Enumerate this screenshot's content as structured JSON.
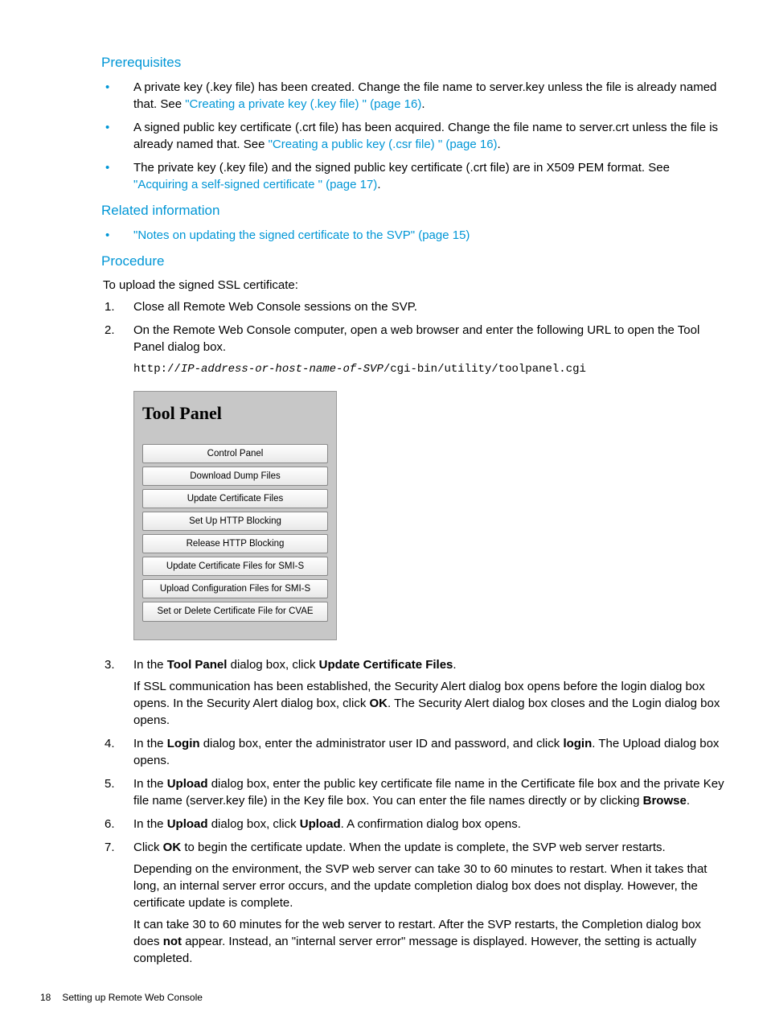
{
  "headings": {
    "prerequisites": "Prerequisites",
    "related": "Related information",
    "procedure": "Procedure"
  },
  "prereq": {
    "items": [
      {
        "text_a": "A private key (.key file) has been created. Change the file name to server.key unless the file is already named that. See ",
        "link": "\"Creating a private key (.key file) \" (page 16)",
        "text_b": "."
      },
      {
        "text_a": "A signed public key certificate (.crt file) has been acquired. Change the file name to server.crt unless the file is already named that. See ",
        "link": "\"Creating a public key (.csr file) \" (page 16)",
        "text_b": "."
      },
      {
        "text_a": "The private key (.key file) and the signed public key certificate (.crt file) are in X509 PEM format. See ",
        "link": "\"Acquiring a self-signed certificate \" (page 17)",
        "text_b": "."
      }
    ]
  },
  "related_link": "\"Notes on updating the signed certificate to the SVP\" (page 15)",
  "procedure": {
    "intro": "To upload the signed SSL certificate:",
    "step1": "Close all Remote Web Console sessions on the SVP.",
    "step2": "On the Remote Web Console computer, open a web browser and enter the following URL to open the Tool Panel dialog box.",
    "url_prefix": "http://",
    "url_host": "IP-address-or-host-name-of-SVP",
    "url_path": "/cgi-bin/utility/toolpanel.cgi",
    "step3": {
      "a": "In the ",
      "b1": "Tool Panel",
      "c": " dialog box, click ",
      "b2": "Update Certificate Files",
      "d": ".",
      "p1a": "If SSL communication has been established, the Security Alert dialog box opens before the login dialog box opens. In the Security Alert dialog box, click ",
      "p1b": "OK",
      "p1c": ". The Security Alert dialog box closes and the Login dialog box opens."
    },
    "step4": {
      "a": "In the ",
      "b1": "Login",
      "c": " dialog box, enter the administrator user ID and password, and click ",
      "b2": "login",
      "d": ". The Upload dialog box opens."
    },
    "step5": {
      "a": "In the ",
      "b1": "Upload",
      "c": " dialog box, enter the public key certificate file name in the Certificate file box and the private Key file name (server.key file) in the Key file box. You can enter the file names directly or by clicking ",
      "b2": "Browse",
      "d": "."
    },
    "step6": {
      "a": "In the ",
      "b1": "Upload",
      "c": " dialog box, click ",
      "b2": "Upload",
      "d": ". A confirmation dialog box opens."
    },
    "step7": {
      "a": "Click ",
      "b1": "OK",
      "c": " to begin the certificate update. When the update is complete, the SVP web server restarts.",
      "p1": "Depending on the environment, the SVP web server can take 30 to 60 minutes to restart. When it takes that long, an internal server error occurs, and the update completion dialog box does not display. However, the certificate update is complete.",
      "p2a": "It can take 30 to 60 minutes for the web server to restart. After the SVP restarts, the Completion dialog box does ",
      "p2b": "not",
      "p2c": " appear. Instead, an \"internal server error\" message is displayed. However, the setting is actually completed."
    }
  },
  "tool_panel": {
    "title": "Tool Panel",
    "buttons": [
      "Control Panel",
      "Download Dump Files",
      "Update Certificate Files",
      "Set Up HTTP Blocking",
      "Release HTTP Blocking",
      "Update Certificate Files for SMI-S",
      "Upload Configuration Files for SMI-S",
      "Set or Delete Certificate File for CVAE"
    ]
  },
  "footer": {
    "page": "18",
    "section": "Setting up Remote Web Console"
  }
}
